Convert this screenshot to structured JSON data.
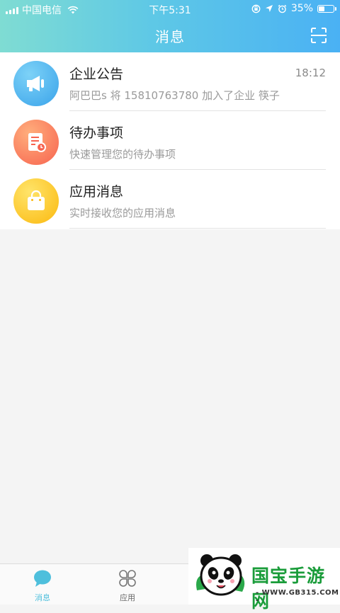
{
  "status_bar": {
    "carrier": "中国电信",
    "time": "下午5:31",
    "battery": "35%",
    "battery_level": 0.35
  },
  "header": {
    "title": "消息",
    "scan_icon": "scan-icon"
  },
  "messages": [
    {
      "icon": "megaphone-icon",
      "color": "#3aa3ea",
      "name": "企业公告",
      "subtitle": "阿巴巴s 将 15810763780 加入了企业 筷子",
      "time": "18:12"
    },
    {
      "icon": "task-document-icon",
      "color": "#f7634f",
      "name": "待办事项",
      "subtitle": "快速管理您的待办事项",
      "time": ""
    },
    {
      "icon": "shopping-bag-icon",
      "color": "#fbb90f",
      "name": "应用消息",
      "subtitle": "实时接收您的应用消息",
      "time": ""
    }
  ],
  "tabbar": {
    "tabs": [
      {
        "label": "消息",
        "icon": "chat-bubble-icon",
        "active": true
      },
      {
        "label": "应用",
        "icon": "four-leaf-apps-icon",
        "active": false
      }
    ],
    "active_color": "#4ebfdc"
  },
  "watermark": {
    "title": "国宝手游网",
    "url": "- WWW.GB315.COM -",
    "logo": "panda-logo"
  }
}
